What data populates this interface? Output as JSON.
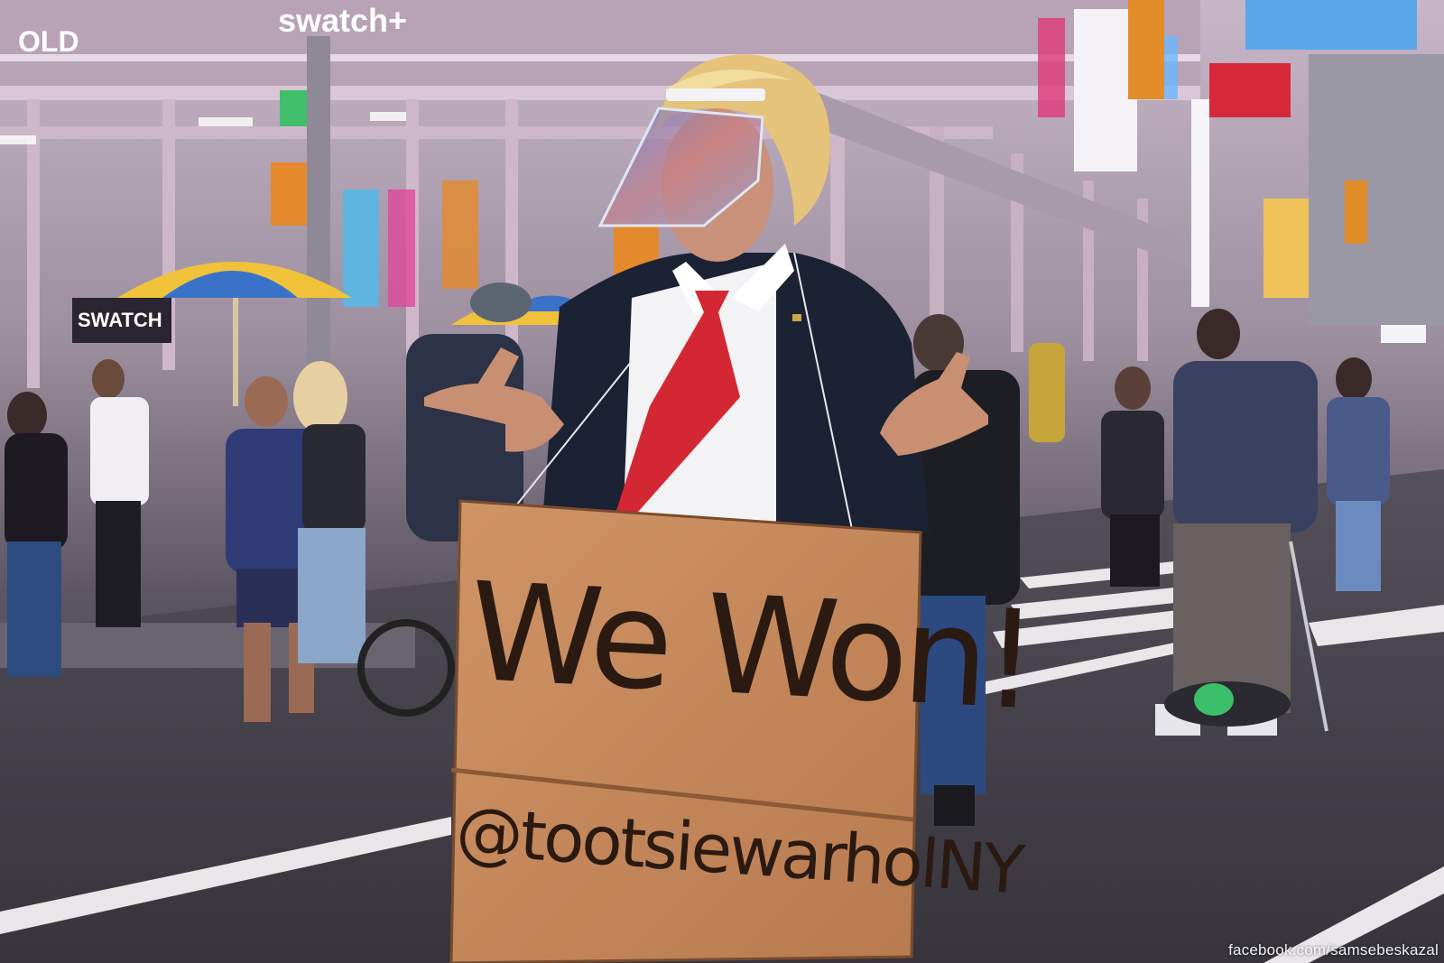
{
  "photo": {
    "sign_line_1": "We Won!",
    "sign_line_2": "@tootsiewarholNY",
    "watermark": "facebook.com/samsebeskazal",
    "store_sign_top": "swatch+",
    "store_sign_left": "OLD",
    "store_sign_lower": "SWATCH"
  },
  "colors": {
    "sky_top": "#c9b6c9",
    "street": "#3b3840",
    "cardboard": "#c58a5c",
    "tie": "#d42a36",
    "jacket": "#1c2233",
    "wig": "#e7c47b"
  }
}
